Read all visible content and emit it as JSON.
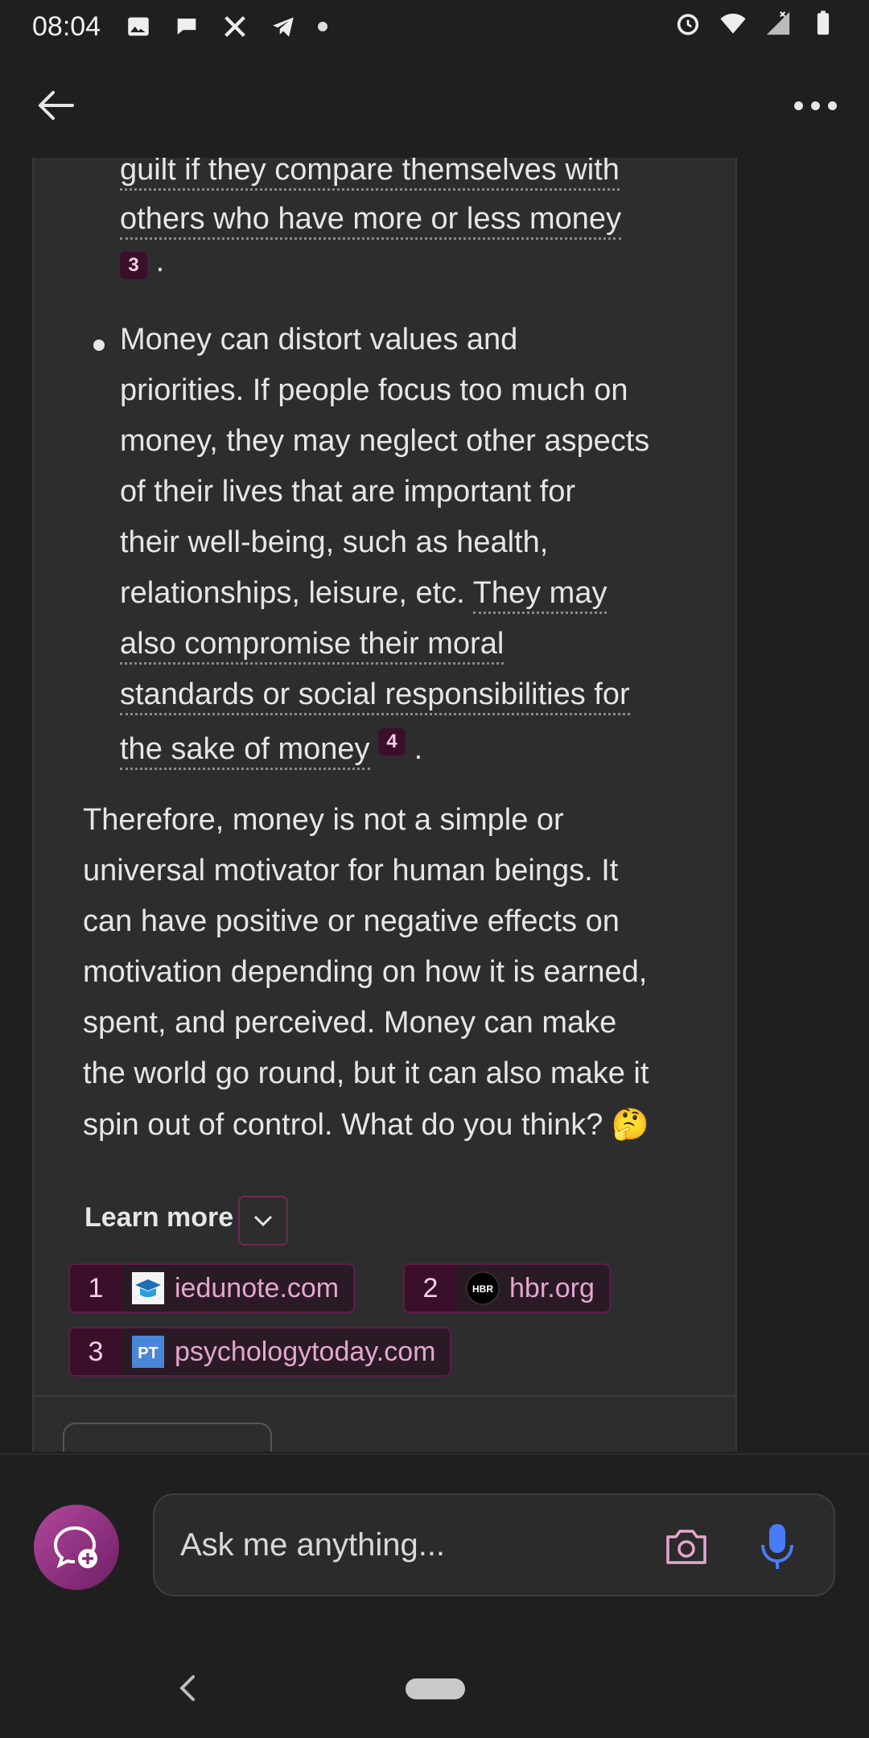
{
  "status_bar": {
    "time": "08:04",
    "left_icons": [
      "image-icon",
      "chat-bubble-icon",
      "x-logo-icon",
      "telegram-icon",
      "dot-icon"
    ],
    "right_icons": [
      "alarm-icon",
      "wifi-icon",
      "signal-icon",
      "battery-icon"
    ]
  },
  "topbar": {
    "back_icon": "arrow-left-icon",
    "more_icon": "more-horizontal-icon"
  },
  "message": {
    "bullet_partial_lines": [
      "guilt if they compare themselves with",
      "others who have more or less money"
    ],
    "bullet_partial_cite": "3",
    "bullet_partial_tail": ".",
    "bullet2_lines": [
      "Money can distort values and",
      "priorities. If people focus too much on",
      "money, they may neglect other aspects",
      "of their lives that are important for",
      "their well-being, such as health,"
    ],
    "bullet2_line6_plain": "relationships, leisure, etc. ",
    "bullet2_line6_ul": "They may",
    "bullet2_ul_lines": [
      "also compromise their moral",
      "standards or social responsibilities for"
    ],
    "bullet2_last_ul": "the sake of money",
    "bullet2_cite": "4",
    "bullet2_tail": ".",
    "paragraph_lines": [
      "Therefore, money is not a simple or",
      "universal motivator for human beings. It",
      "can have positive or negative effects on",
      "motivation depending on how it is earned,",
      "spent, and perceived. Money can make",
      "the world go round, but it can also make it",
      "spin out of control. What do you think? 🤔"
    ],
    "learn_more": "Learn more",
    "sources": [
      {
        "num": "1",
        "label": "iedunote.com",
        "icon": "graduation-cap-icon"
      },
      {
        "num": "2",
        "label": "hbr.org",
        "icon": "hbr-logo-icon"
      },
      {
        "num": "3",
        "label": "psychologytoday.com",
        "icon": "pt-logo-icon"
      }
    ]
  },
  "composer": {
    "placeholder": "Ask me anything...",
    "camera_icon": "camera-icon",
    "mic_icon": "microphone-icon",
    "new_topic_icon": "new-chat-icon"
  },
  "colors": {
    "background": "#1f1f1f",
    "card": "#2d2d2d",
    "accent": "#b3479c",
    "citation_bg": "#3b0f2a",
    "source_text": "#e4a7cf",
    "mic_blue": "#4a7bf7"
  }
}
